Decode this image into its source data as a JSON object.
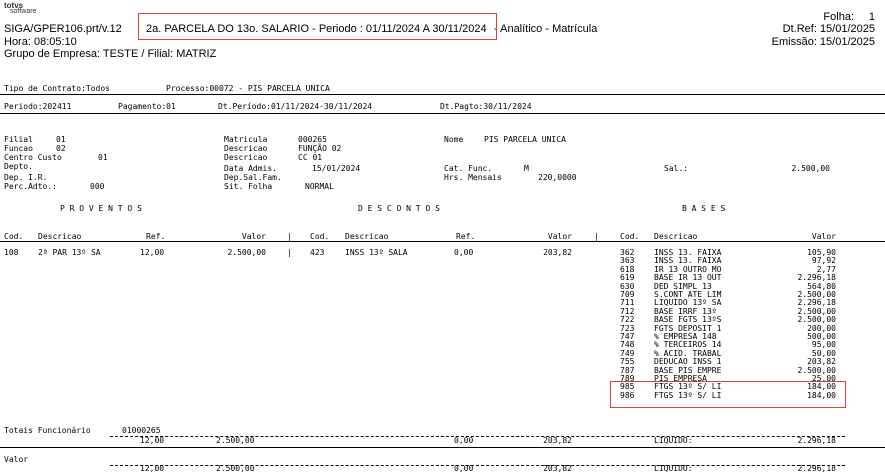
{
  "header": {
    "logo_line1": "totvs",
    "logo_line2": "software",
    "program": "SIGA/GPER106.prt/v.12",
    "title": "2a. PARCELA DO 13o. SALARIO - Periodo : 01/11/2024 A 30/11/2024",
    "title_suffix": "- Analítico - Matrícula",
    "hora": "Hora: 08:05:10",
    "grupo": "Grupo de Empresa: TESTE / Filial: MATRIZ",
    "folha_label": "Folha:",
    "folha_value": "1",
    "dtref": "Dt.Ref: 15/01/2025",
    "emissao": "Emissão: 15/01/2025"
  },
  "params": {
    "tipo": "Tipo de Contrato:Todos",
    "processo": "Processo:00072 - PIS PARCELA UNICA",
    "periodo": "Periodo:202411",
    "pagamento": "Pagamento:01",
    "dtperiodo": "Dt.Período:01/11/2024-30/11/2024",
    "dtpagto": "Dt.Pagto:30/11/2024"
  },
  "employee": {
    "filial_l": "Filial",
    "filial_v": "01",
    "funcao_l": "Funcao",
    "funcao_v": "02",
    "centro_l": "Centro Custo",
    "centro_v": "01",
    "depto_l": "Depto.",
    "depir_l": "Dep. I.R.",
    "perc_l": "Perc.Adto.:",
    "perc_v": "000",
    "matricula_l": "Matricula",
    "matricula_v": "000265",
    "desc1_l": "Descricao",
    "desc1_v": "FUNÇÃO 02",
    "desc2_l": "Descricao",
    "desc2_v": "CC 01",
    "admis_l": "Data Admis.",
    "admis_v": "15/01/2024",
    "depsal_l": "Dep.Sal.Fam.",
    "sit_l": "Sit. Folha",
    "sit_v": "NORMAL",
    "nome_l": "Nome",
    "nome_v": "PIS PARCELA UNICA",
    "cat_l": "Cat. Func.",
    "cat_v": "M",
    "hrs_l": "Hrs. Mensais",
    "hrs_v": "220,0000",
    "sal_l": "Sal.:",
    "sal_v": "2.500,00"
  },
  "sections": {
    "proventos": "P R O V E N T O S",
    "descontos": "D E S C O N T O S",
    "bases": "B A S E S"
  },
  "columns": {
    "cod": "Cod.",
    "descricao": "Descricao",
    "ref": "Ref.",
    "valor": "Valor",
    "sep": "|"
  },
  "provento": {
    "cod": "108",
    "desc": "2ª PAR 13º SA",
    "ref": "12,00",
    "valor": "2.500,00"
  },
  "desconto": {
    "cod": "423",
    "desc": "INSS 13º SALA",
    "ref": "0,00",
    "valor": "203,82"
  },
  "bases": [
    {
      "cod": "362",
      "desc": "INSS 13. FAIXA",
      "valor": "105,90"
    },
    {
      "cod": "363",
      "desc": "INSS 13. FAIXA",
      "valor": "97,92"
    },
    {
      "cod": "618",
      "desc": "IR 13 OUTRO MO",
      "valor": "2,77"
    },
    {
      "cod": "619",
      "desc": "BASE IR 13 OUT",
      "valor": "2.296,18"
    },
    {
      "cod": "630",
      "desc": "DED SIMPL 13",
      "valor": "564,80"
    },
    {
      "cod": "709",
      "desc": "S.CONT ATE LIM",
      "valor": "2.500,00"
    },
    {
      "cod": "711",
      "desc": "LIQUIDO 13º SA",
      "valor": "2.296,18"
    },
    {
      "cod": "712",
      "desc": "BASE IRRF 13º",
      "valor": "2.500,00"
    },
    {
      "cod": "722",
      "desc": "BASE FGTS 13ºS",
      "valor": "2.500,00"
    },
    {
      "cod": "723",
      "desc": "FGTS DEPOSIT 1",
      "valor": "200,00"
    },
    {
      "cod": "747",
      "desc": "% EMPRESA 148",
      "valor": "500,00"
    },
    {
      "cod": "748",
      "desc": "% TERCEIROS 14",
      "valor": "95,00"
    },
    {
      "cod": "749",
      "desc": "% ACID. TRABAL",
      "valor": "50,00"
    },
    {
      "cod": "755",
      "desc": "DEDUCAO INSS 1",
      "valor": "203,82"
    },
    {
      "cod": "787",
      "desc": "BASE PIS EMPRE",
      "valor": "2.500,00"
    },
    {
      "cod": "789",
      "desc": "PIS EMPRESA",
      "valor": "25,00"
    },
    {
      "cod": "985",
      "desc": "FTGS 13º S/ LI",
      "valor": "184,00"
    },
    {
      "cod": "986",
      "desc": "FTGS 13º S/ LI",
      "valor": "184,00"
    }
  ],
  "totais": {
    "label": "Totais Funcionário",
    "matricula": "01000265",
    "ref_prov": "12,00",
    "val_prov": "2.500,00",
    "ref_desc": "0,00",
    "val_desc": "203,82",
    "liq_label": "LIQUIDO:",
    "liq_value": "2.296,18"
  },
  "valor_total": {
    "label": "Valor",
    "ref_prov": "12,00",
    "val_prov": "2.500,00",
    "ref_desc": "0,00",
    "val_desc": "203,82",
    "liq_label": "LIQUIDO:",
    "liq_value": "2.296,18"
  },
  "colors": {
    "highlight": "#d9403a"
  }
}
